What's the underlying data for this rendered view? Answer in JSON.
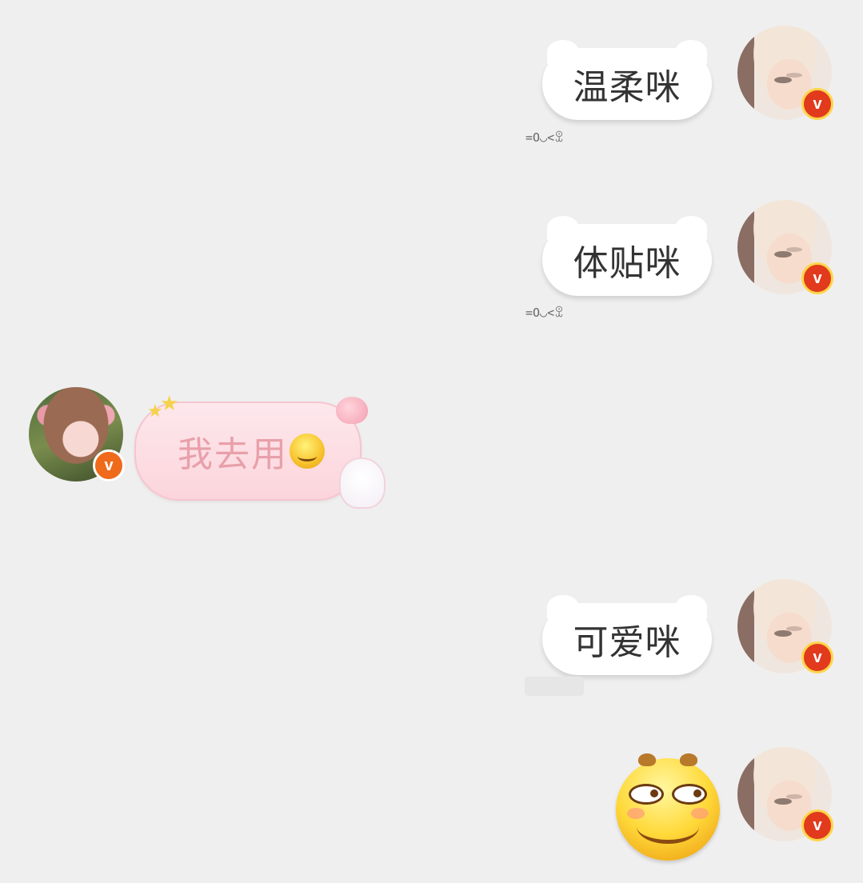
{
  "messages": [
    {
      "side": "right",
      "text": "温柔咪",
      "caption": "=O◡<ꀾ",
      "verified": "v"
    },
    {
      "side": "right",
      "text": "体贴咪",
      "caption": "=O◡<ꀾ",
      "verified": "v"
    },
    {
      "side": "left",
      "text": "我去用",
      "emoji": "grin-emoji",
      "verified": "v"
    },
    {
      "side": "right",
      "text": "可爱咪",
      "caption": "",
      "verified": "v"
    },
    {
      "side": "right",
      "sticker": "big-smirk-emoji",
      "verified": "v"
    }
  ],
  "colors": {
    "background": "#efefef",
    "bubble_right": "#ffffff",
    "bubble_left": "#fbd5dc",
    "left_text": "#e8a0aa",
    "badge_red": "#e23a1c",
    "badge_orange": "#ef6a1a"
  }
}
